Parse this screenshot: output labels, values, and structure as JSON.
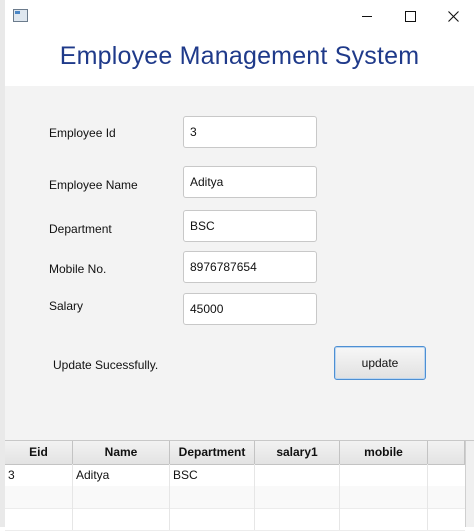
{
  "window": {
    "title": "",
    "minimize_glyph": "minimize-icon",
    "maximize_glyph": "maximize-icon",
    "close_glyph": "close-icon"
  },
  "header": {
    "title": "Employee Management System",
    "title_color": "#1f3a8a"
  },
  "form": {
    "fields": [
      {
        "label": "Employee Id",
        "value": "3"
      },
      {
        "label": "Employee Name",
        "value": "Aditya"
      },
      {
        "label": "Department",
        "value": "BSC"
      },
      {
        "label": "Mobile No.",
        "value": "8976787654"
      },
      {
        "label": "Salary",
        "value": "45000"
      }
    ],
    "status_text": "Update Sucessfully.",
    "update_label": "update"
  },
  "table": {
    "columns": [
      "Eid",
      "Name",
      "Department",
      "salary1",
      "mobile"
    ],
    "rows": [
      [
        "3",
        "Aditya",
        "BSC",
        "",
        ""
      ]
    ]
  }
}
